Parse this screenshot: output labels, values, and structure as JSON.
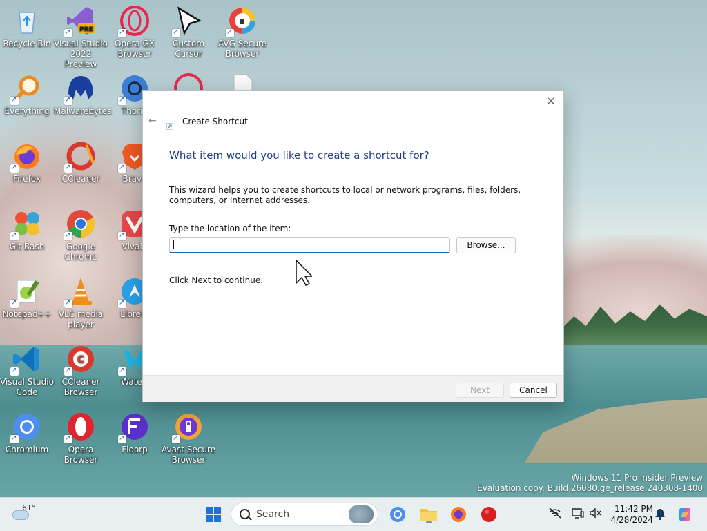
{
  "desktop": {
    "icons": [
      {
        "label": "Recycle Bin"
      },
      {
        "label": "Visual Studio 2022 Preview",
        "badge": "PRE"
      },
      {
        "label": "Opera GX Browser"
      },
      {
        "label": "Custom Cursor"
      },
      {
        "label": "AVG Secure Browser"
      },
      {
        "label": "Everything"
      },
      {
        "label": "Malwarebytes"
      },
      {
        "label": "Thoriu"
      },
      {
        "label": "Firefox"
      },
      {
        "label": "CCleaner"
      },
      {
        "label": "Brave"
      },
      {
        "label": "Git Bash"
      },
      {
        "label": "Google Chrome"
      },
      {
        "label": "Vivald"
      },
      {
        "label": "Notepad++"
      },
      {
        "label": "VLC media player"
      },
      {
        "label": "LibreW"
      },
      {
        "label": "Visual Studio Code"
      },
      {
        "label": "CCleaner Browser"
      },
      {
        "label": "Waterf"
      },
      {
        "label": "Chromium"
      },
      {
        "label": "Opera Browser"
      },
      {
        "label": "Floorp"
      },
      {
        "label": "Avast Secure Browser"
      }
    ]
  },
  "watermark": {
    "line1": "Windows 11 Pro Insider Preview",
    "line2": "Evaluation copy. Build 26080.ge_release.240308-1400"
  },
  "dialog": {
    "title": "Create Shortcut",
    "heading": "What item would you like to create a shortcut for?",
    "description": "This wizard helps you to create shortcuts to local or network programs, files, folders, computers, or Internet addresses.",
    "location_label": "Type the location of the item:",
    "location_value": "",
    "browse_label": "Browse...",
    "continue_text": "Click Next to continue.",
    "next_label": "Next",
    "cancel_label": "Cancel",
    "close_glyph": "✕",
    "back_glyph": "←"
  },
  "taskbar": {
    "weather_temp": "61°",
    "search_placeholder": "Search",
    "time": "11:42 PM",
    "date": "4/28/2024"
  },
  "colors": {
    "accent": "#1e5fbf",
    "heading": "#1e3e8a"
  }
}
